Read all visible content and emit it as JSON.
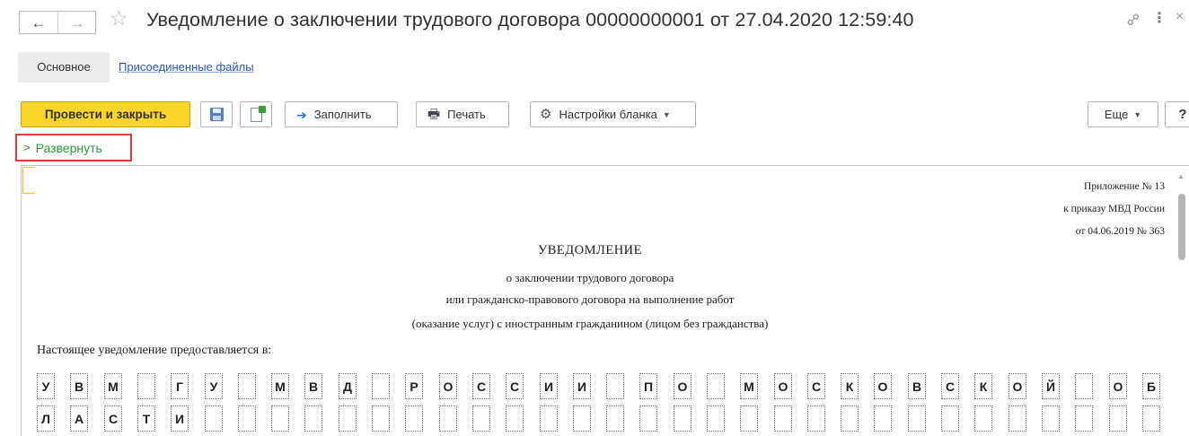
{
  "window": {
    "title": "Уведомление о заключении трудового договора 00000000001 от 27.04.2020 12:59:40"
  },
  "tabs": [
    {
      "label": "Основное"
    },
    {
      "label": "Присоединенные файлы"
    }
  ],
  "toolbar": {
    "post_and_close": "Провести и закрыть",
    "fill": "Заполнить",
    "print": "Печать",
    "form_settings": "Настройки бланка",
    "more": "Еще",
    "help": "?"
  },
  "expand_link": "Развернуть",
  "document": {
    "appendix_line1": "Приложение № 13",
    "appendix_line2": "к приказу МВД России",
    "appendix_line3": "от 04.06.2019 № 363",
    "heading": "УВЕДОМЛЕНИЕ",
    "subheading_1": "о заключении трудового договора",
    "subheading_2": "или гражданско-правового договора на выполнение работ",
    "subheading_3": "(оказание услуг) с иностранным гражданином (лицом без гражданства)",
    "intro": "Настоящее уведомление предоставляется в:",
    "row1_chars": [
      "У",
      "В",
      "М",
      "",
      "Г",
      "У",
      "",
      "М",
      "В",
      "Д",
      "",
      "Р",
      "О",
      "С",
      "С",
      "И",
      "И",
      "",
      "П",
      "О",
      "",
      "М",
      "О",
      "С",
      "К",
      "О",
      "В",
      "С",
      "К",
      "О",
      "Й",
      "",
      "О",
      "Б"
    ],
    "row2_chars": [
      "Л",
      "А",
      "С",
      "Т",
      "И",
      "",
      "",
      "",
      "",
      "",
      "",
      "",
      "",
      "",
      "",
      "",
      "",
      "",
      "",
      "",
      "",
      "",
      "",
      "",
      "",
      "",
      "",
      "",
      "",
      "",
      "",
      "",
      "",
      ""
    ]
  }
}
